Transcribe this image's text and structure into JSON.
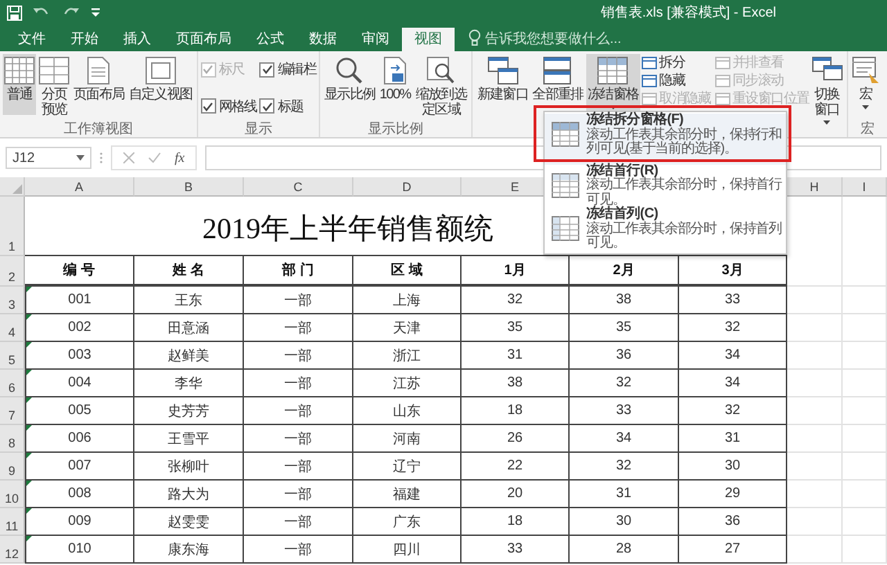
{
  "window": {
    "title": "销售表.xls [兼容模式] - Excel"
  },
  "tabs": [
    {
      "label": "文件",
      "selected": false
    },
    {
      "label": "开始",
      "selected": false
    },
    {
      "label": "插入",
      "selected": false
    },
    {
      "label": "页面布局",
      "selected": false
    },
    {
      "label": "公式",
      "selected": false
    },
    {
      "label": "数据",
      "selected": false
    },
    {
      "label": "审阅",
      "selected": false
    },
    {
      "label": "视图",
      "selected": true
    }
  ],
  "tell_me": {
    "placeholder": "告诉我您想要做什么..."
  },
  "ribbon": {
    "workbook_views": {
      "label": "工作簿视图",
      "buttons": [
        {
          "label": "普通",
          "selected": true
        },
        {
          "label": "分页预览",
          "selected": false
        },
        {
          "label": "页面布局",
          "selected": false
        },
        {
          "label": "自定义视图",
          "selected": false
        }
      ]
    },
    "show": {
      "label": "显示",
      "options": [
        {
          "label": "标尺",
          "checked": true,
          "disabled": true
        },
        {
          "label": "编辑栏",
          "checked": true,
          "disabled": false
        },
        {
          "label": "网格线",
          "checked": true,
          "disabled": false
        },
        {
          "label": "标题",
          "checked": true,
          "disabled": false
        }
      ]
    },
    "zoom": {
      "label": "显示比例",
      "buttons": [
        {
          "label": "显示比例"
        },
        {
          "label": "100%"
        },
        {
          "label": "缩放到选定区域"
        }
      ]
    },
    "window": {
      "buttons": [
        {
          "label": "新建窗口",
          "selected": false
        },
        {
          "label": "全部重排",
          "selected": false
        },
        {
          "label": "冻结窗格",
          "selected": true
        }
      ],
      "small_buttons": [
        {
          "label": "拆分",
          "disabled": false
        },
        {
          "label": "隐藏",
          "disabled": false
        },
        {
          "label": "取消隐藏",
          "disabled": true
        },
        {
          "label": "并排查看",
          "disabled": true
        },
        {
          "label": "同步滚动",
          "disabled": true
        },
        {
          "label": "重设窗口位置",
          "disabled": true
        }
      ],
      "switch_button": "切换窗口"
    },
    "macros": {
      "label": "宏",
      "button": "宏"
    }
  },
  "freeze_menu": [
    {
      "title": "冻结拆分窗格(F)",
      "description": "滚动工作表其余部分时，保持行和列可见(基于当前的选择)。",
      "selected": true
    },
    {
      "title": "冻结首行(R)",
      "description": "滚动工作表其余部分时，保持首行可见。",
      "selected": false
    },
    {
      "title": "冻结首列(C)",
      "description": "滚动工作表其余部分时，保持首列可见。",
      "selected": false
    }
  ],
  "formula_bar": {
    "name_box": "J12",
    "function_button": "fx"
  },
  "sheet": {
    "column_headers": [
      "A",
      "B",
      "C",
      "D",
      "E",
      "H",
      "I"
    ],
    "row_headers": [
      "1",
      "2",
      "3",
      "4",
      "5",
      "6",
      "7",
      "8",
      "9",
      "10",
      "11",
      "12"
    ],
    "title": "2019年上半年销售额统",
    "columns": [
      "编 号",
      "姓 名",
      "部 门",
      "区 域",
      "1月",
      "2月",
      "3月"
    ],
    "rows": [
      [
        "001",
        "王东",
        "一部",
        "上海",
        "32",
        "38",
        "33"
      ],
      [
        "002",
        "田意涵",
        "一部",
        "天津",
        "35",
        "35",
        "32"
      ],
      [
        "003",
        "赵鲜美",
        "一部",
        "浙江",
        "31",
        "36",
        "34"
      ],
      [
        "004",
        "李华",
        "一部",
        "江苏",
        "38",
        "32",
        "34"
      ],
      [
        "005",
        "史芳芳",
        "一部",
        "山东",
        "18",
        "33",
        "32"
      ],
      [
        "006",
        "王雪平",
        "一部",
        "河南",
        "26",
        "34",
        "31"
      ],
      [
        "007",
        "张柳叶",
        "一部",
        "辽宁",
        "22",
        "32",
        "30"
      ],
      [
        "008",
        "路大为",
        "一部",
        "福建",
        "20",
        "31",
        "29"
      ],
      [
        "009",
        "赵雯雯",
        "一部",
        "广东",
        "18",
        "30",
        "36"
      ],
      [
        "010",
        "康东海",
        "一部",
        "四川",
        "33",
        "28",
        "27"
      ]
    ]
  }
}
